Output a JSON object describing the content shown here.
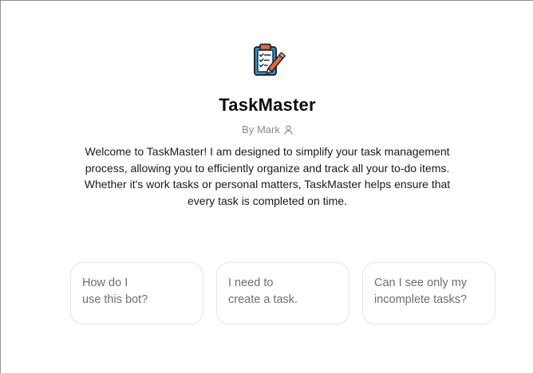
{
  "gpt": {
    "name": "TaskMaster",
    "author": "By Mark",
    "avatar_icon": "clipboard-checklist-pencil-icon",
    "author_icon": "user-icon",
    "description": "Welcome to TaskMaster! I am designed to simplify your task management process, allowing you to efficiently organize and track all your to-do items. Whether it's work tasks or personal matters, TaskMaster helps ensure that every task is completed on time."
  },
  "conversation_starters": [
    {
      "line1": "How do I",
      "line2": "use this bot?"
    },
    {
      "line1": "I need to",
      "line2": "create a task."
    },
    {
      "line1": "Can I see only my",
      "line2": "incomplete tasks?"
    }
  ],
  "colors": {
    "title": "#0d0d0d",
    "muted": "#8a8a8a",
    "card_border": "#e6e6e6",
    "clipboard": "#3a8ec0",
    "pencil": "#e8683a"
  }
}
